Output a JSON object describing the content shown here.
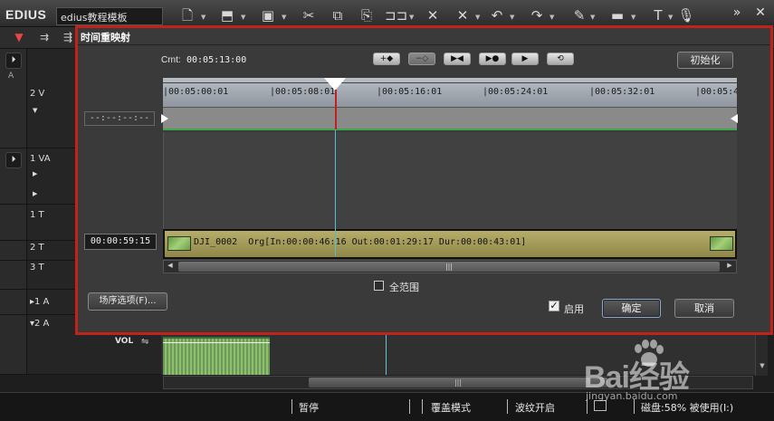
{
  "app": {
    "title": "EDIUS",
    "project_name": "edius教程模板"
  },
  "colors": {
    "dialog_border": "#c0231c",
    "clip": "#a9a15c",
    "cursor": "#4fc0cc",
    "playhead": "#c21f1f",
    "keyframe_line": "#3fa84a"
  },
  "toolbar": {
    "icons": [
      "new-project-icon",
      "open-project-icon",
      "save-icon",
      "cut-icon",
      "copy-icon",
      "paste-icon",
      "replace-icon",
      "delete-icon",
      "ripple-delete-icon",
      "undo-icon",
      "redo-icon",
      "marker-icon",
      "toggle-icon",
      "title-icon",
      "mic-icon"
    ],
    "right": [
      "»",
      "✕"
    ]
  },
  "tracks": [
    {
      "name": "2 V"
    },
    {
      "name": "1 VA"
    },
    {
      "name": "1 T"
    },
    {
      "name": "2 T"
    },
    {
      "name": "3 T"
    },
    {
      "name": "▸1 A"
    },
    {
      "name": "▾2 A"
    }
  ],
  "vol_label": "VOL",
  "left_header": "A",
  "dialog": {
    "title": "时间重映射",
    "crnt_label": "Crnt:",
    "crnt_value": "00:05:13:00",
    "init_button": "初始化",
    "controls": [
      "+◆",
      "−◇",
      "▶◀",
      "▶●",
      "▶",
      "⟲"
    ],
    "ruler_ticks": [
      "|00:05:00:01",
      "|00:05:08:01",
      "|00:05:16:01",
      "|00:05:24:01",
      "|00:05:32:01",
      "|00:05:4"
    ],
    "tc_top": "--:--:--:--",
    "tc_clip": "00:00:59:15",
    "clip_name": "DJI_0002",
    "clip_info": "Org[In:00:00:46:16 Out:00:01:29:17 Dur:00:00:43:01]",
    "full_range_label": "全范围",
    "scene_button": "场序选项(F)...",
    "enable_label": "启用",
    "ok_button": "确定",
    "cancel_button": "取消"
  },
  "status": {
    "pause": "暂停",
    "overwrite": "覆盖模式",
    "ripple": "波纹开启",
    "disk": "磁盘:58% 被使用(I:)"
  },
  "watermark": {
    "brand": "Bai经验",
    "url": "jingyan.baidu.com"
  }
}
